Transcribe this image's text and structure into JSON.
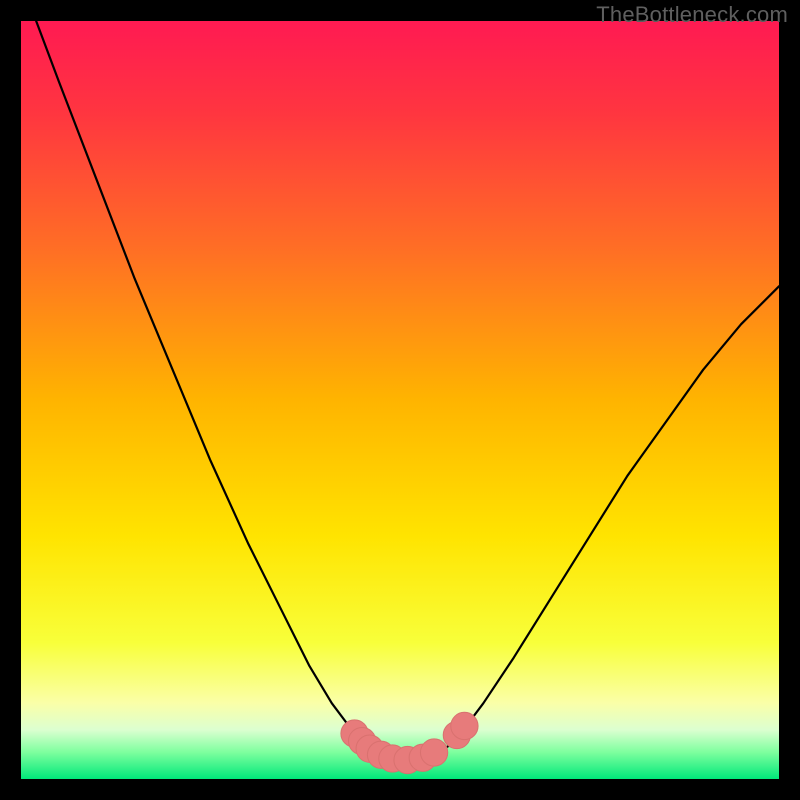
{
  "attribution": "TheBottleneck.com",
  "colors": {
    "frame": "#000000",
    "curve": "#000000",
    "marker_fill": "#e77b7b",
    "marker_stroke": "#d9716f",
    "gradient_stops": [
      {
        "offset": 0.0,
        "color": "#ff1a52"
      },
      {
        "offset": 0.12,
        "color": "#ff3540"
      },
      {
        "offset": 0.3,
        "color": "#ff6e25"
      },
      {
        "offset": 0.5,
        "color": "#ffb400"
      },
      {
        "offset": 0.68,
        "color": "#ffe400"
      },
      {
        "offset": 0.82,
        "color": "#f8ff3a"
      },
      {
        "offset": 0.9,
        "color": "#faffa8"
      },
      {
        "offset": 0.935,
        "color": "#dcffd0"
      },
      {
        "offset": 0.965,
        "color": "#7dff9e"
      },
      {
        "offset": 1.0,
        "color": "#00e87a"
      }
    ]
  },
  "chart_data": {
    "type": "line",
    "title": "",
    "xlabel": "",
    "ylabel": "",
    "xlim": [
      0,
      100
    ],
    "ylim": [
      0,
      100
    ],
    "grid": false,
    "series": [
      {
        "name": "bottleneck-curve",
        "x": [
          2,
          5,
          10,
          15,
          20,
          25,
          30,
          35,
          38,
          41,
          44,
          46,
          48,
          50,
          52,
          54,
          56,
          58,
          61,
          65,
          70,
          75,
          80,
          85,
          90,
          95,
          100
        ],
        "y": [
          100,
          92,
          79,
          66,
          54,
          42,
          31,
          21,
          15,
          10,
          6,
          4,
          3,
          2.5,
          2.5,
          3,
          4,
          6,
          10,
          16,
          24,
          32,
          40,
          47,
          54,
          60,
          65
        ]
      }
    ],
    "markers": [
      {
        "x": 44.0,
        "y": 6.0
      },
      {
        "x": 45.0,
        "y": 5.0
      },
      {
        "x": 46.0,
        "y": 4.0
      },
      {
        "x": 47.5,
        "y": 3.2
      },
      {
        "x": 49.0,
        "y": 2.7
      },
      {
        "x": 51.0,
        "y": 2.5
      },
      {
        "x": 53.0,
        "y": 2.8
      },
      {
        "x": 54.5,
        "y": 3.5
      },
      {
        "x": 57.5,
        "y": 5.8
      },
      {
        "x": 58.5,
        "y": 7.0
      }
    ],
    "marker_radius_data_units": 1.8
  }
}
